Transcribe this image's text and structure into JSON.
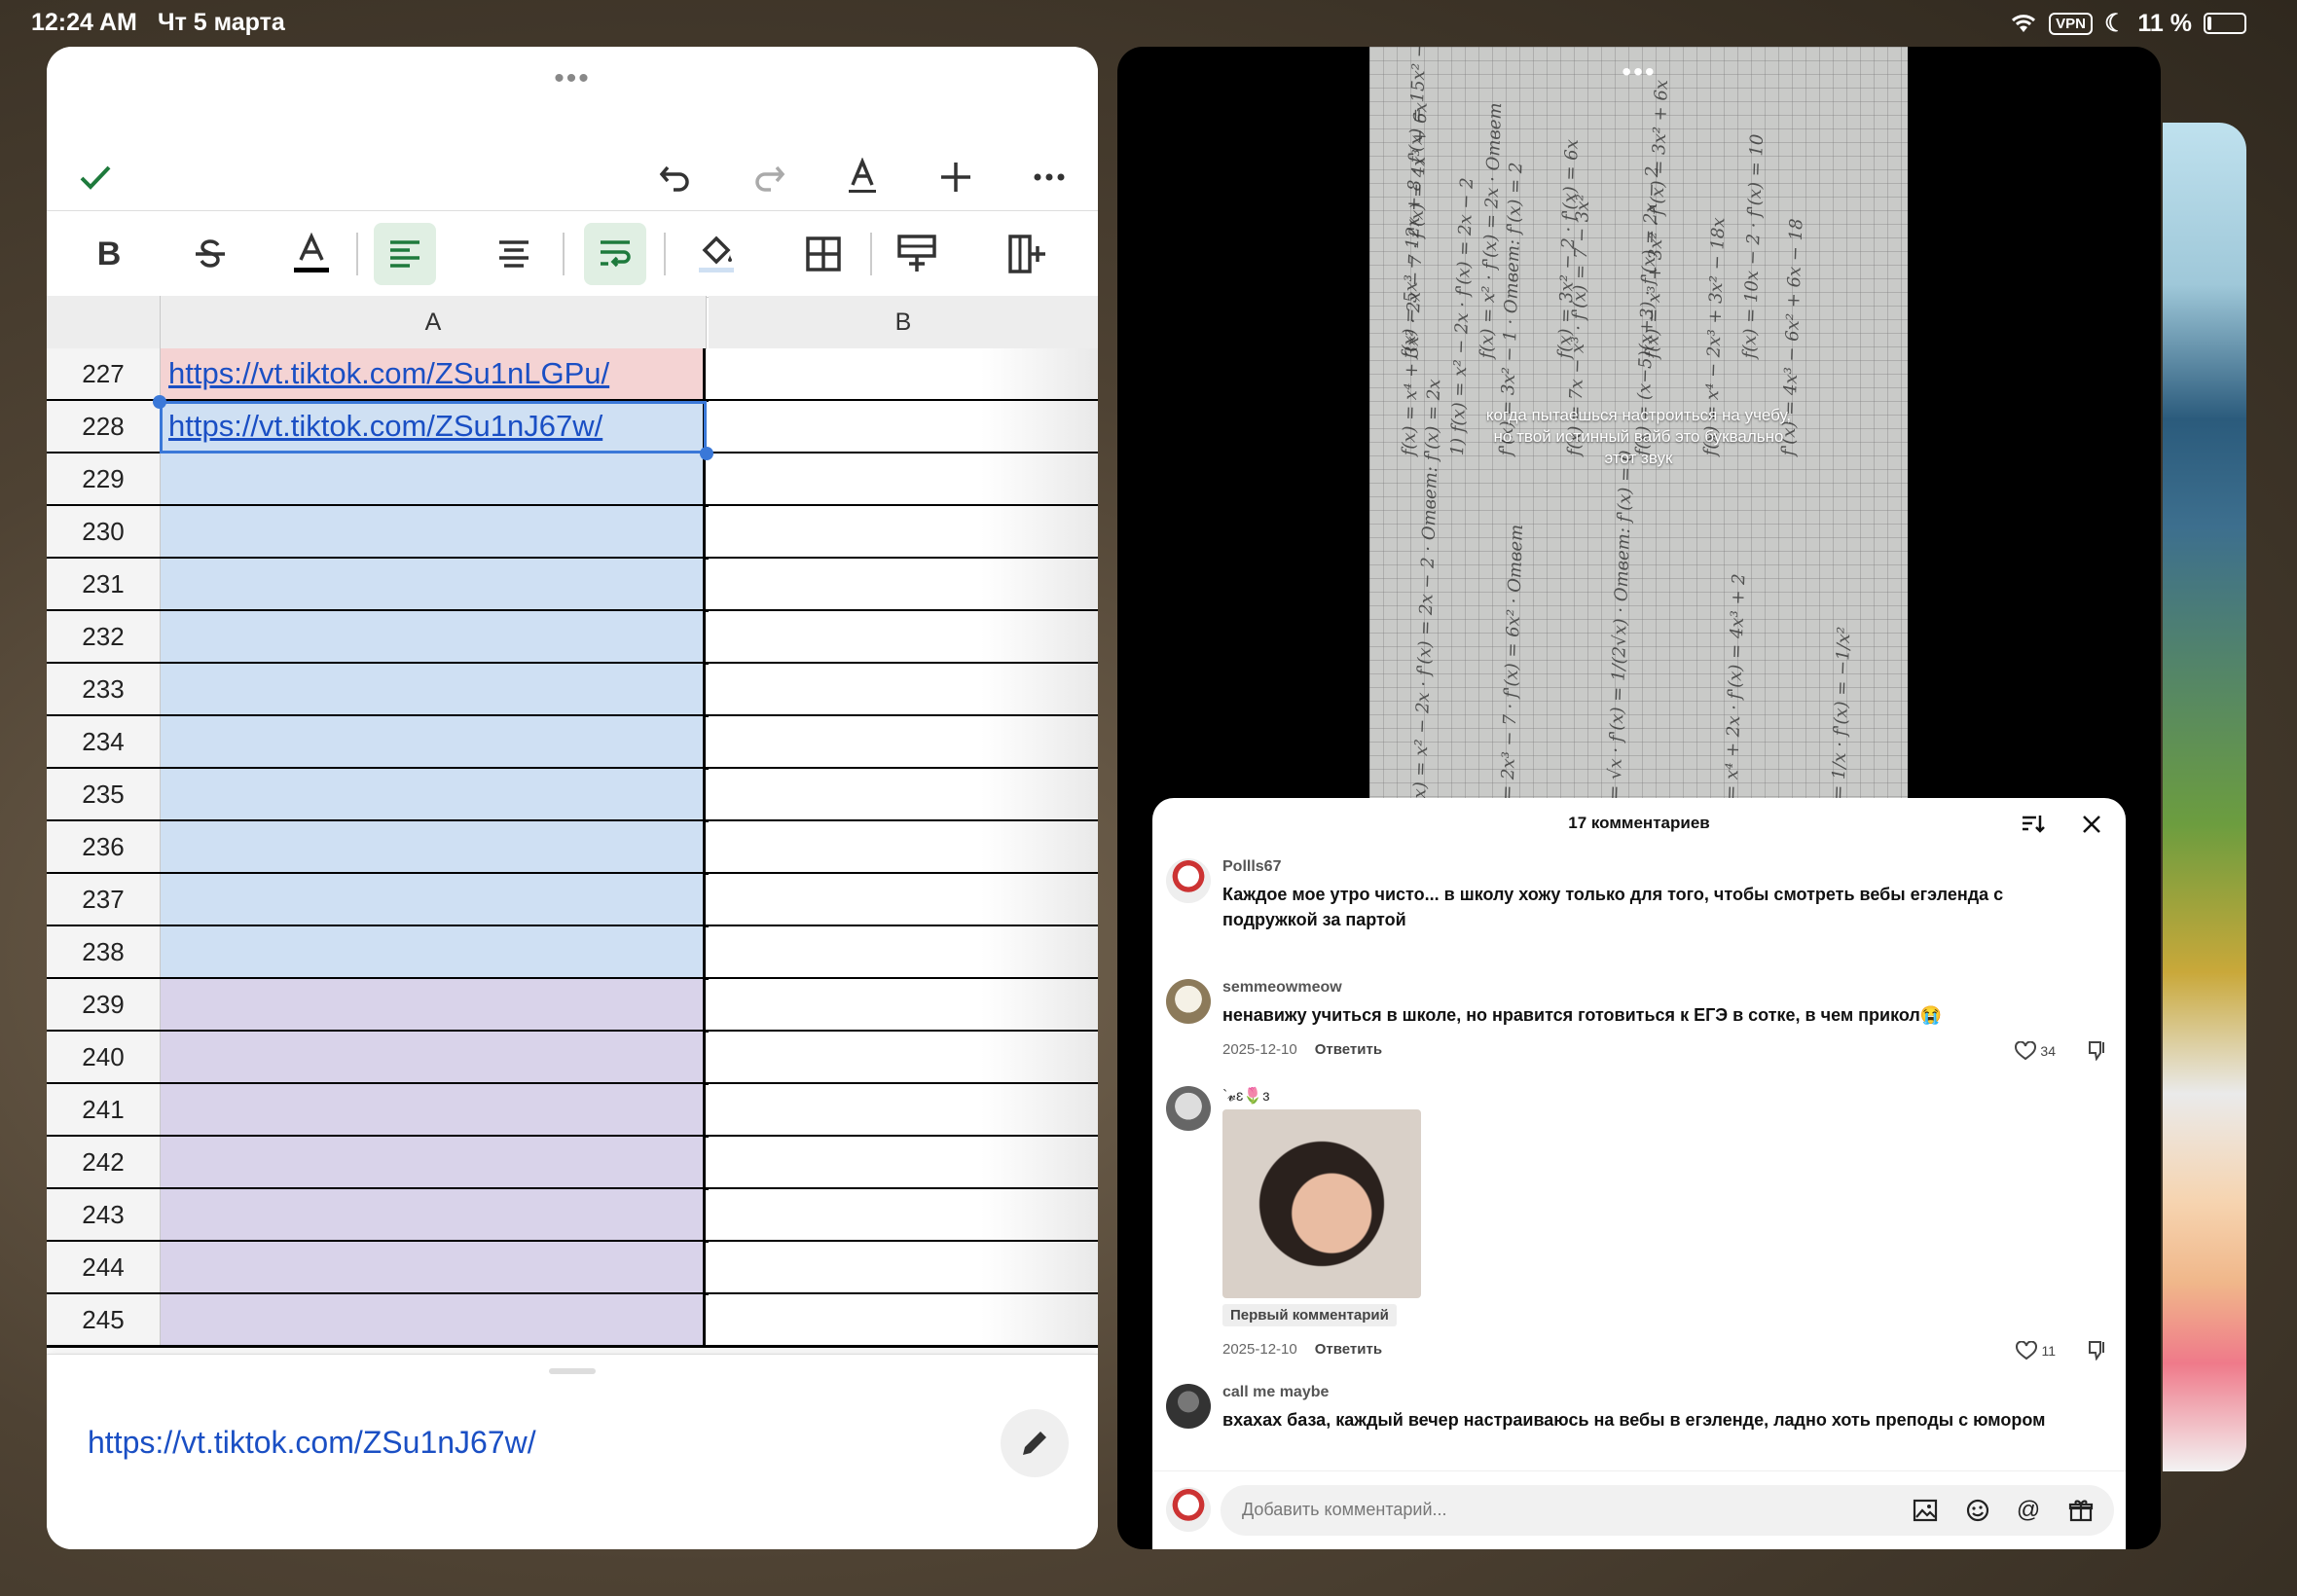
{
  "status_bar": {
    "time": "12:24 AM",
    "date": "Чт 5 марта",
    "vpn": "VPN",
    "battery": "11 %"
  },
  "sheet": {
    "toolbar_icons": [
      "checkmark-icon",
      "undo-icon",
      "redo-icon",
      "text-format-icon",
      "insert-plus-icon",
      "more-icon"
    ],
    "format_icons": [
      "bold-icon",
      "strikethrough-icon",
      "text-color-icon",
      "align-left-icon",
      "align-center-icon",
      "wrap-text-icon",
      "fill-color-icon",
      "borders-icon",
      "insert-row-icon",
      "insert-column-icon"
    ],
    "bold_label": "B",
    "col_a": "A",
    "col_b": "B",
    "rows": [
      {
        "num": "227",
        "a": "https://vt.tiktok.com/ZSu1nLGPu/",
        "color": "#f4d3d3"
      },
      {
        "num": "228",
        "a": "https://vt.tiktok.com/ZSu1nJ67w/",
        "color": "#cfe0f3"
      },
      {
        "num": "229",
        "a": "",
        "color": "#cfe0f3"
      },
      {
        "num": "230",
        "a": "",
        "color": "#cfe0f3"
      },
      {
        "num": "231",
        "a": "",
        "color": "#cfe0f3"
      },
      {
        "num": "232",
        "a": "",
        "color": "#cfe0f3"
      },
      {
        "num": "233",
        "a": "",
        "color": "#cfe0f3"
      },
      {
        "num": "234",
        "a": "",
        "color": "#cfe0f3"
      },
      {
        "num": "235",
        "a": "",
        "color": "#cfe0f3"
      },
      {
        "num": "236",
        "a": "",
        "color": "#cfe0f3"
      },
      {
        "num": "237",
        "a": "",
        "color": "#cfe0f3"
      },
      {
        "num": "238",
        "a": "",
        "color": "#cfe0f3"
      },
      {
        "num": "239",
        "a": "",
        "color": "#d9d3ea"
      },
      {
        "num": "240",
        "a": "",
        "color": "#d9d3ea"
      },
      {
        "num": "241",
        "a": "",
        "color": "#d9d3ea"
      },
      {
        "num": "242",
        "a": "",
        "color": "#d9d3ea"
      },
      {
        "num": "243",
        "a": "",
        "color": "#d9d3ea"
      },
      {
        "num": "244",
        "a": "",
        "color": "#d9d3ea"
      },
      {
        "num": "245",
        "a": "",
        "color": "#d9d3ea"
      }
    ],
    "editor_value": "https://vt.tiktok.com/ZSu1nJ67w/"
  },
  "video": {
    "caption_line1": "когда пытаешься настроиться на учебу,",
    "caption_line2": "но твой истинный вайб это буквально",
    "caption_line3": "этот звук"
  },
  "comments": {
    "header": "17 комментариев",
    "items": [
      {
        "user": "Pollls67",
        "text": "Каждое мое утро чисто... в школу хожу только для того, чтобы смотреть вебы егэленда с подружкой за партой"
      },
      {
        "user": "semmeowmeow",
        "text": "ненавижу учиться в школе, но нравится готовиться к ЕГЭ в сотке, в чем прикол😭",
        "date": "2025-12-10",
        "reply": "Ответить",
        "likes": "34"
      },
      {
        "user": "`𝓿ɛ🌷ɜ",
        "badge": "Первый комментарий",
        "date": "2025-12-10",
        "reply": "Ответить",
        "likes": "11"
      },
      {
        "user": "call me maybe",
        "text": "вхахах база, каждый вечер настраиваюсь на вебы в егэленде, ладно хоть преподы с юмором"
      }
    ],
    "input_placeholder": "Добавить комментарий..."
  }
}
